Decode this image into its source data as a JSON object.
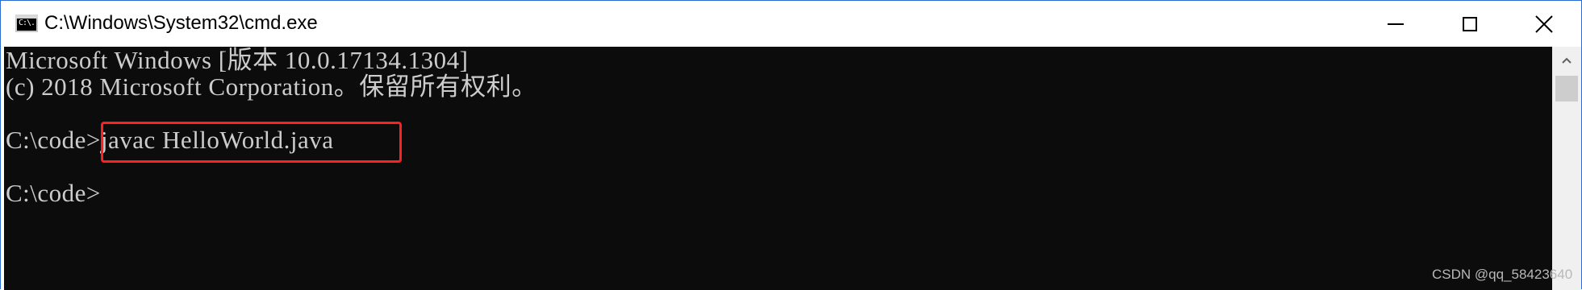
{
  "window": {
    "title": "C:\\Windows\\System32\\cmd.exe",
    "icon_label": "C:\\."
  },
  "controls": {
    "minimize": "minimize-icon",
    "maximize": "maximize-icon",
    "close": "close-icon"
  },
  "console": {
    "lines": [
      "Microsoft Windows [版本 10.0.17134.1304]",
      "(c) 2018 Microsoft Corporation。保留所有权利。"
    ],
    "prompt_1": "C:\\code>",
    "command_1": "javac HelloWorld.java",
    "prompt_2": "C:\\code>"
  },
  "colors": {
    "console_bg": "#0c0c0c",
    "console_text": "#cccccc",
    "highlight": "#ff2020",
    "window_border": "#2b6cd3"
  },
  "watermark": "CSDN @qq_58423640"
}
